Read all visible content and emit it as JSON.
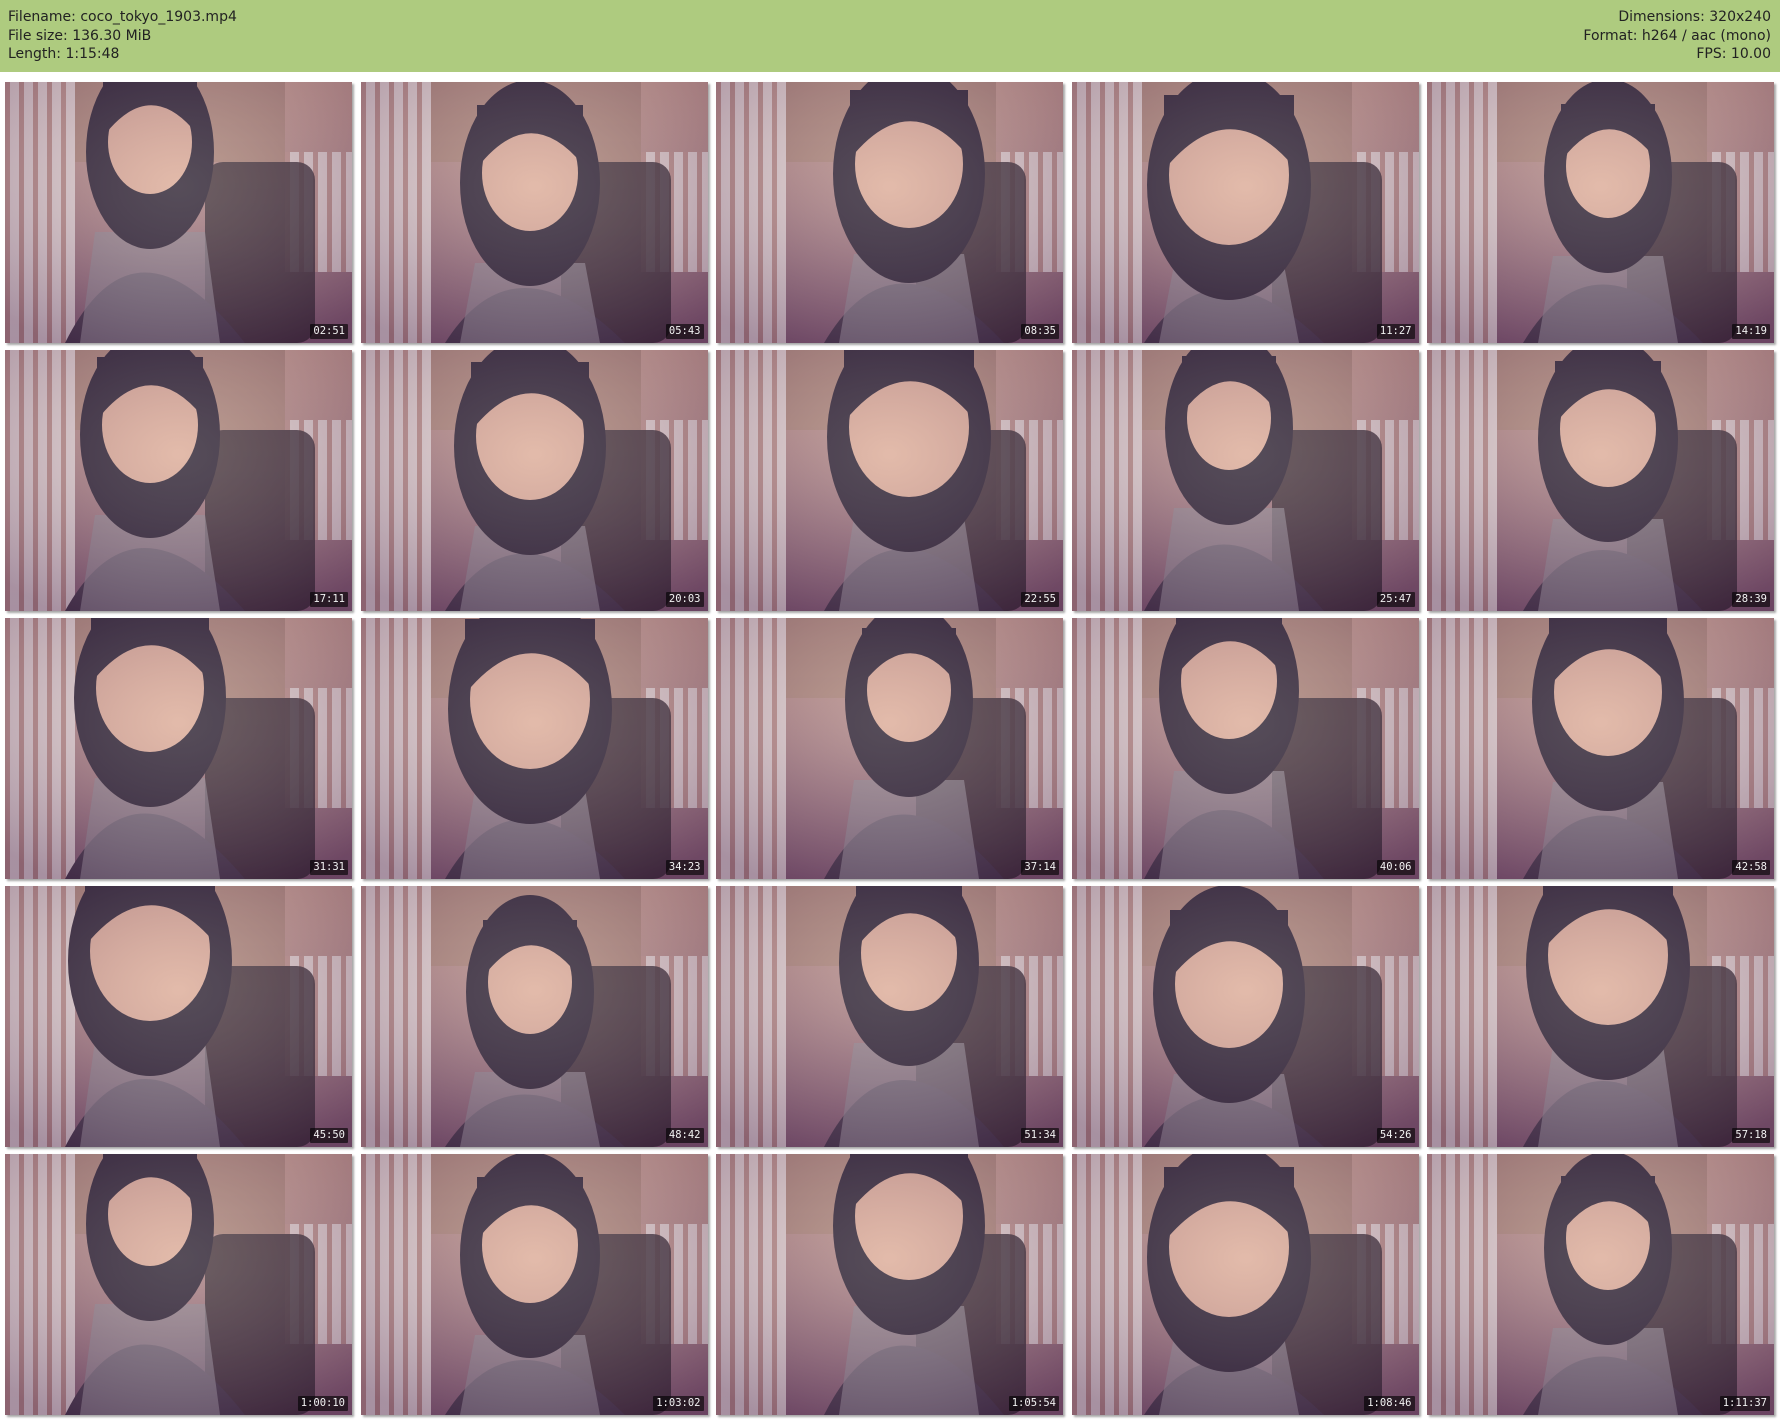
{
  "header": {
    "filename_label": "Filename:",
    "filename": "coco_tokyo_1903.mp4",
    "filesize_label": "File size:",
    "filesize": "136.30 MiB",
    "length_label": "Length:",
    "length": "1:15:48",
    "dimensions_label": "Dimensions:",
    "dimensions": "320x240",
    "format_label": "Format:",
    "format": "h264 / aac (mono)",
    "fps_label": "FPS:",
    "fps": "10.00"
  },
  "thumbnails": [
    {
      "timestamp": "02:51"
    },
    {
      "timestamp": "05:43"
    },
    {
      "timestamp": "08:35"
    },
    {
      "timestamp": "11:27"
    },
    {
      "timestamp": "14:19"
    },
    {
      "timestamp": "17:11"
    },
    {
      "timestamp": "20:03"
    },
    {
      "timestamp": "22:55"
    },
    {
      "timestamp": "25:47"
    },
    {
      "timestamp": "28:39"
    },
    {
      "timestamp": "31:31"
    },
    {
      "timestamp": "34:23"
    },
    {
      "timestamp": "37:14"
    },
    {
      "timestamp": "40:06"
    },
    {
      "timestamp": "42:58"
    },
    {
      "timestamp": "45:50"
    },
    {
      "timestamp": "48:42"
    },
    {
      "timestamp": "51:34"
    },
    {
      "timestamp": "54:26"
    },
    {
      "timestamp": "57:18"
    },
    {
      "timestamp": "1:00:10"
    },
    {
      "timestamp": "1:03:02"
    },
    {
      "timestamp": "1:05:54"
    },
    {
      "timestamp": "1:08:46"
    },
    {
      "timestamp": "1:11:37"
    }
  ],
  "colors": {
    "header_bg": "#aecb7f",
    "page_bg": "#ffffff"
  }
}
